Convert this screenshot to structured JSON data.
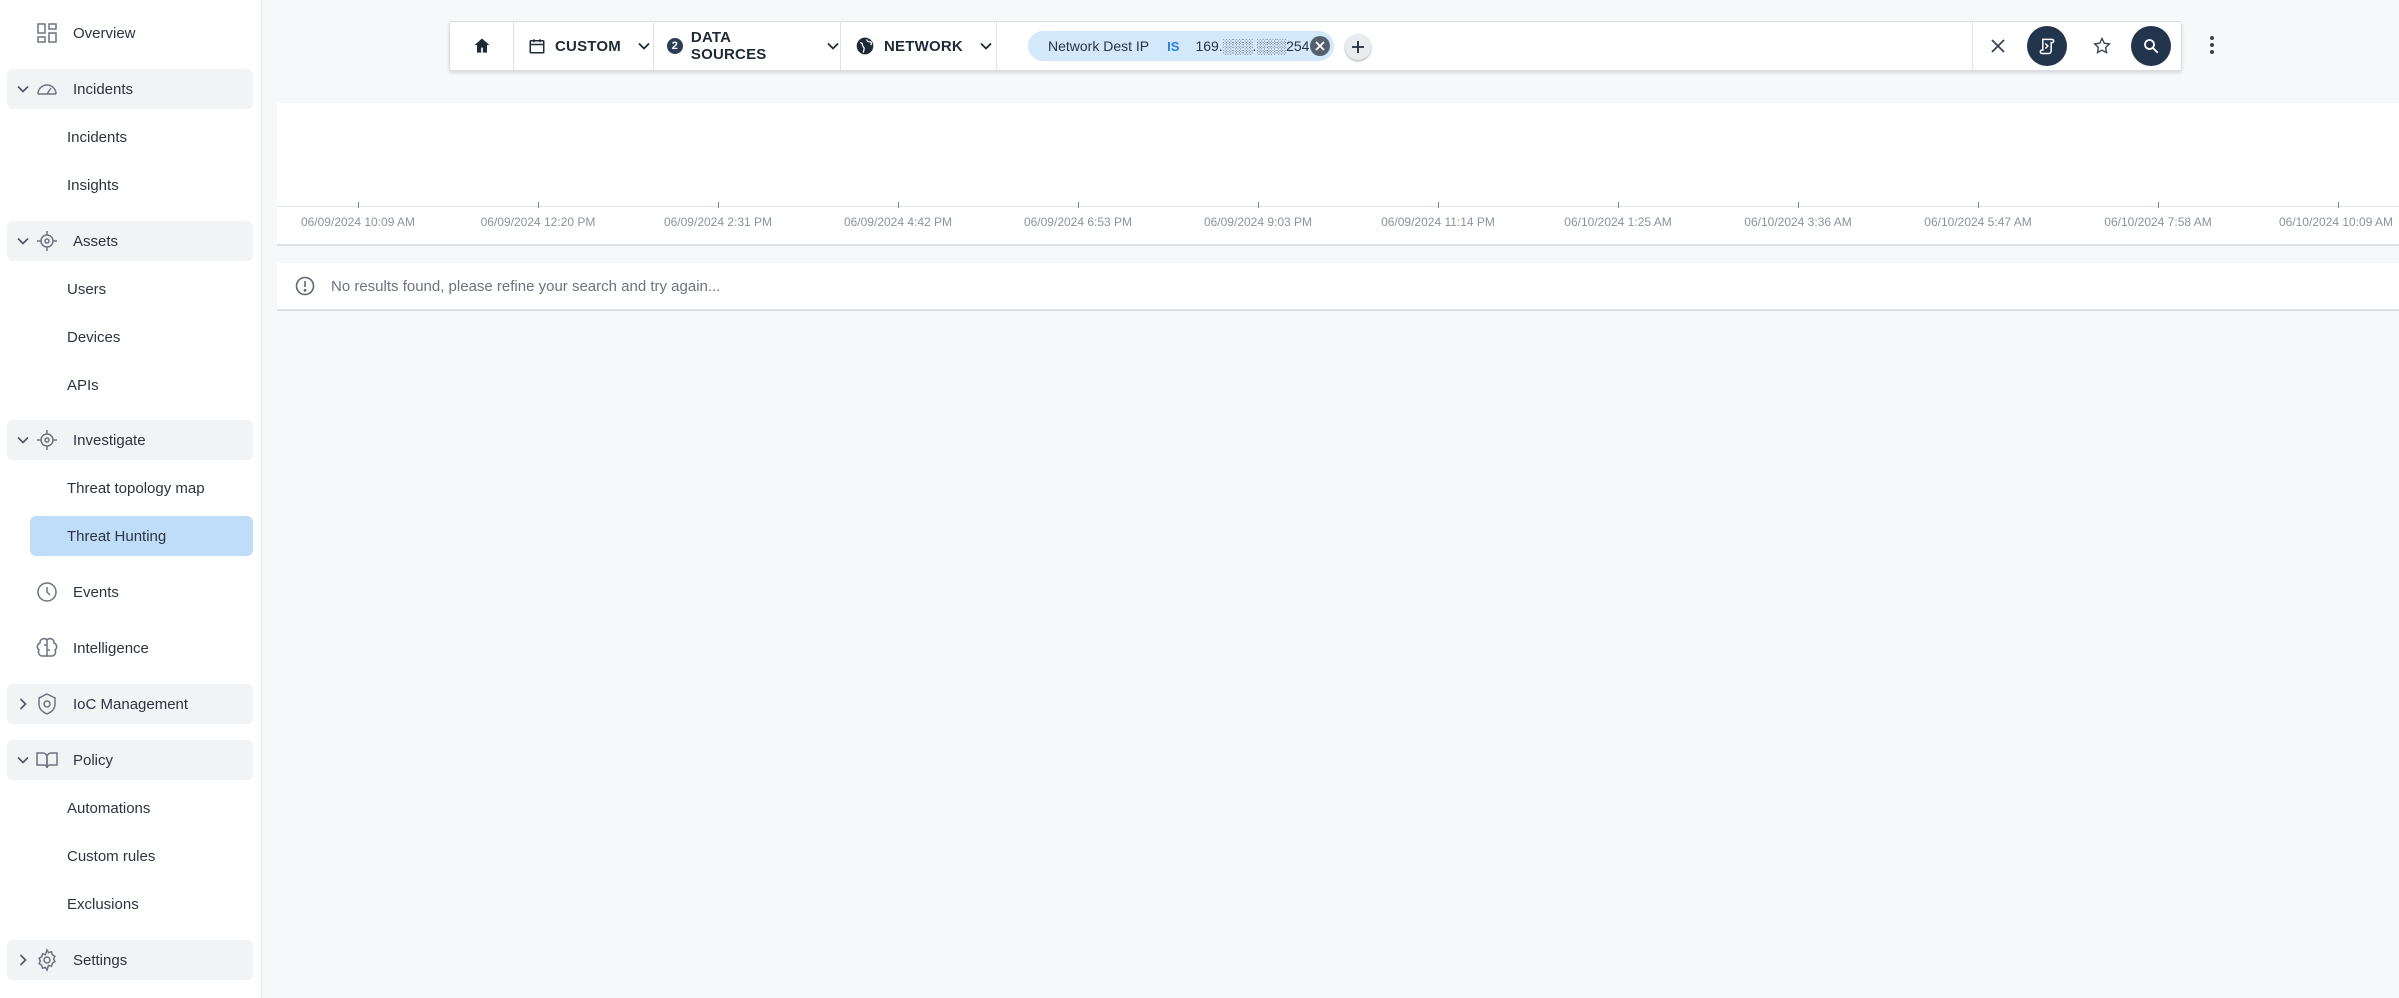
{
  "sidebar": {
    "overview": "Overview",
    "incidents_group": "Incidents",
    "incidents_items": [
      "Incidents",
      "Insights"
    ],
    "assets_group": "Assets",
    "assets_items": [
      "Users",
      "Devices",
      "APIs"
    ],
    "investigate_group": "Investigate",
    "investigate_items": [
      "Threat topology map",
      "Threat Hunting"
    ],
    "active_item": "Threat Hunting",
    "events": "Events",
    "intelligence": "Intelligence",
    "ioc_group": "IoC Management",
    "policy_group": "Policy",
    "policy_items": [
      "Automations",
      "Custom rules",
      "Exclusions"
    ],
    "settings_group": "Settings"
  },
  "query_bar": {
    "time_range": "CUSTOM",
    "data_sources_count": "2",
    "data_sources_label": "DATA SOURCES",
    "category": "NETWORK",
    "filter": {
      "field": "Network Dest IP",
      "operator": "IS",
      "value": "169.░░░.░░░254"
    }
  },
  "timeline": {
    "ticks": [
      "06/09/2024 10:09 AM",
      "06/09/2024 12:20 PM",
      "06/09/2024 2:31 PM",
      "06/09/2024 4:42 PM",
      "06/09/2024 6:53 PM",
      "06/09/2024 9:03 PM",
      "06/09/2024 11:14 PM",
      "06/10/2024 1:25 AM",
      "06/10/2024 3:36 AM",
      "06/10/2024 5:47 AM",
      "06/10/2024 7:58 AM",
      "06/10/2024 10:09 AM"
    ]
  },
  "results": {
    "empty_message": "No results found, please refine your search and try again..."
  },
  "colors": {
    "accent": "#2a7de1",
    "active_nav": "#bfdcf8",
    "dark_button": "#23344d",
    "chip": "#d3e8fb"
  }
}
